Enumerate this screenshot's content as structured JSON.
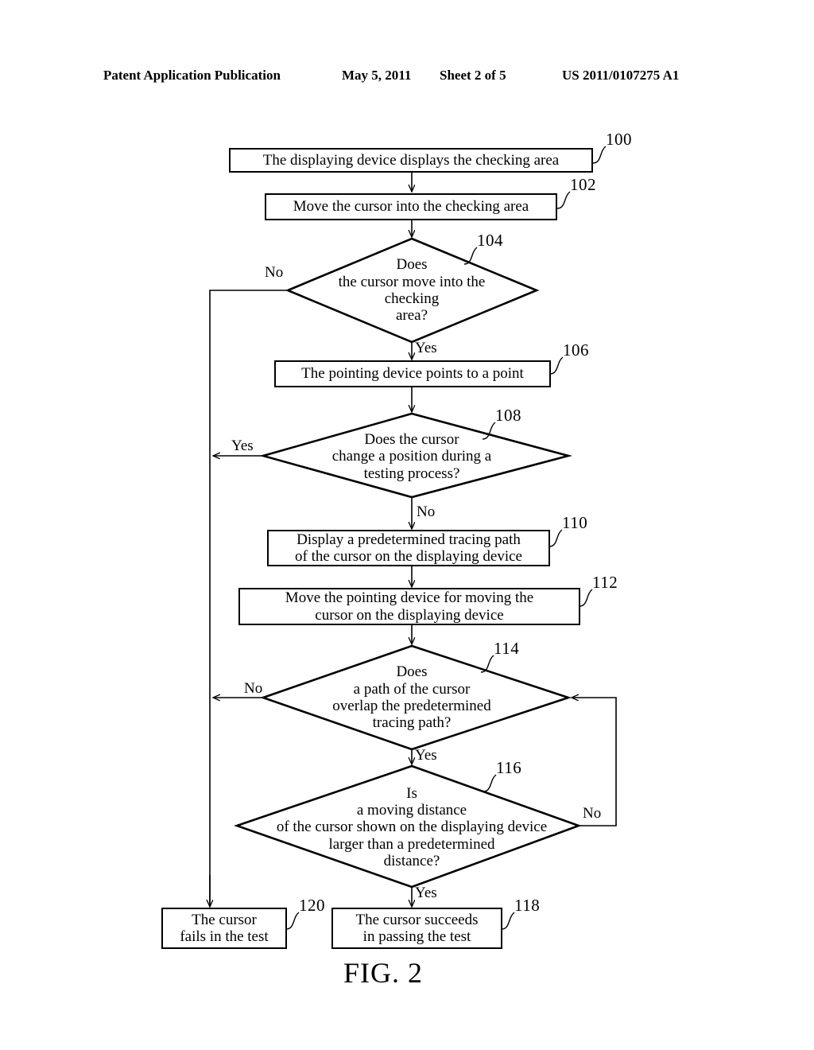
{
  "header": {
    "publication": "Patent Application Publication",
    "date": "May 5, 2011",
    "sheet": "Sheet 2 of 5",
    "patent_number": "US 2011/0107275 A1"
  },
  "figure": {
    "caption": "FIG. 2",
    "nodes": [
      {
        "ref": "100",
        "shape": "box",
        "text": "The displaying device displays the checking area"
      },
      {
        "ref": "102",
        "shape": "box",
        "text": "Move the cursor into the checking area"
      },
      {
        "ref": "104",
        "shape": "diamond",
        "text": "Does\nthe cursor move into the\nchecking\narea?"
      },
      {
        "ref": "106",
        "shape": "box",
        "text": "The pointing device points to a point"
      },
      {
        "ref": "108",
        "shape": "diamond",
        "text": "Does the cursor\nchange a position during a\ntesting process?"
      },
      {
        "ref": "110",
        "shape": "box",
        "text": "Display a predetermined tracing path\nof the cursor on the displaying device"
      },
      {
        "ref": "112",
        "shape": "box",
        "text": "Move the pointing device for moving the\ncursor on the displaying device"
      },
      {
        "ref": "114",
        "shape": "diamond",
        "text": "Does\na path of the cursor\noverlap the predetermined\ntracing path?"
      },
      {
        "ref": "116",
        "shape": "diamond",
        "text": "Is\na moving distance\nof the cursor shown on the displaying device\nlarger than a predetermined\ndistance?"
      },
      {
        "ref": "118",
        "shape": "box",
        "text": "The cursor succeeds\nin passing the test"
      },
      {
        "ref": "120",
        "shape": "box",
        "text": "The cursor\nfails in the test"
      }
    ],
    "edge_labels": {
      "no_104": "No",
      "yes_104": "Yes",
      "yes_108": "Yes",
      "no_108": "No",
      "no_114": "No",
      "yes_114": "Yes",
      "no_116": "No",
      "yes_116": "Yes"
    }
  },
  "colors": {
    "ink": "#000000",
    "paper": "#ffffff"
  }
}
